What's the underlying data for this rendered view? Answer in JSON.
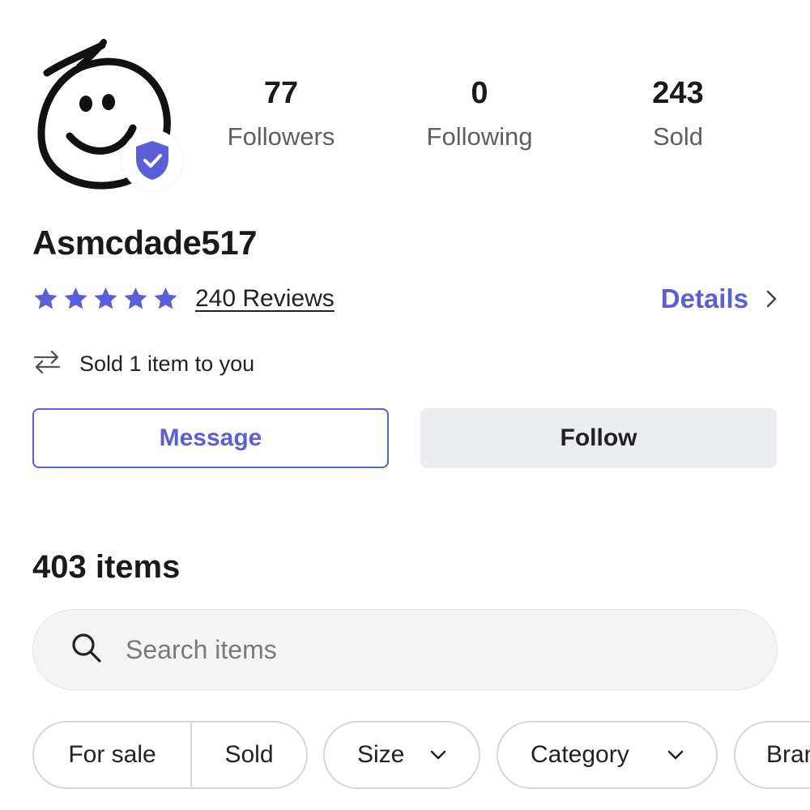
{
  "profile": {
    "username": "Asmcdade517",
    "rating_stars": 5,
    "reviews_label": "240 Reviews",
    "details_label": "Details",
    "sold_to_you": "Sold 1 item to you",
    "accent_color": "#5a5fd6"
  },
  "stats": [
    {
      "value": "77",
      "label": "Followers"
    },
    {
      "value": "0",
      "label": "Following"
    },
    {
      "value": "243",
      "label": "Sold"
    }
  ],
  "actions": {
    "message_label": "Message",
    "follow_label": "Follow"
  },
  "items": {
    "count_label": "403 items",
    "search_placeholder": "Search items"
  },
  "filters": {
    "status_options": [
      "For sale",
      "Sold"
    ],
    "dropdowns": [
      "Size",
      "Category",
      "Brand"
    ]
  },
  "icons": [
    "smiley-avatar-icon",
    "verified-shield-icon",
    "star-icon",
    "chevron-right-icon",
    "swap-arrows-icon",
    "search-icon",
    "chevron-down-icon"
  ]
}
